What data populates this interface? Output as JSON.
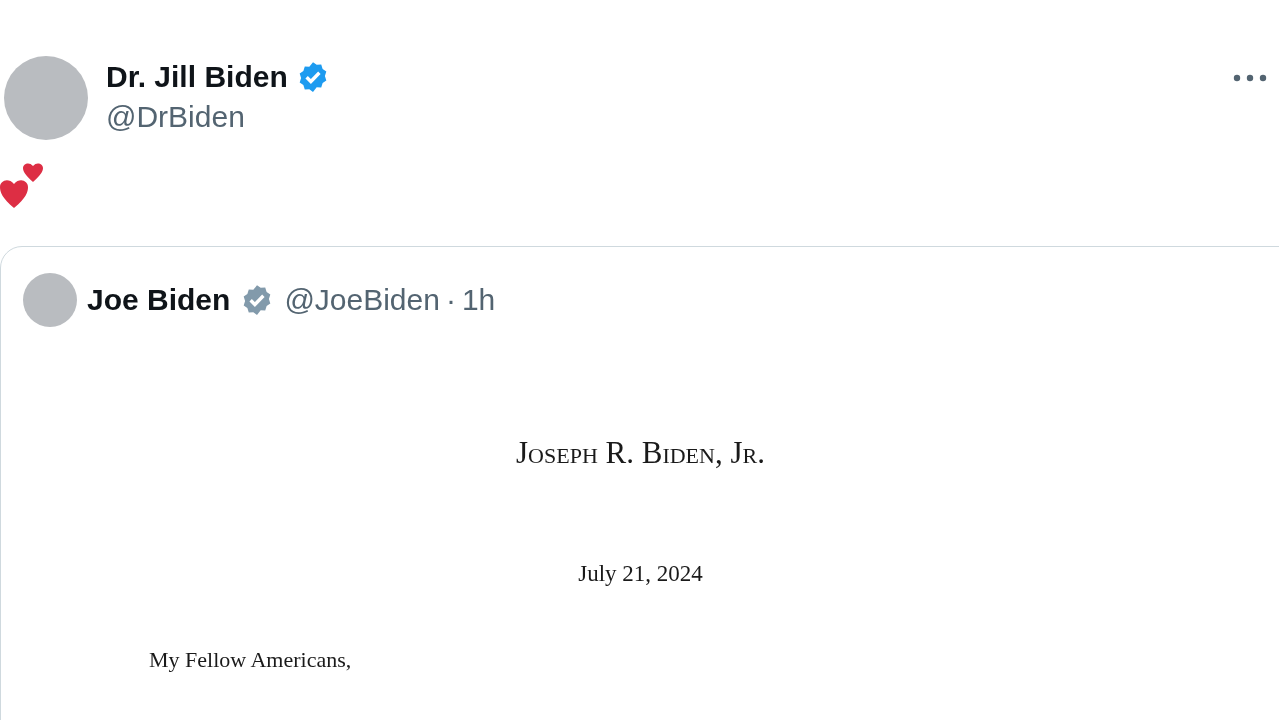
{
  "post": {
    "author": {
      "name": "Dr. Jill Biden",
      "verified": true,
      "handle": "@DrBiden"
    },
    "quote": {
      "author": {
        "name": "Joe Biden",
        "verified": true,
        "handle": "@JoeBiden",
        "separator": "·",
        "time": "1h"
      },
      "document": {
        "letterhead": "Joseph R. Biden, Jr.",
        "date": "July 21, 2024",
        "salutation": "My Fellow Americans,"
      }
    }
  }
}
